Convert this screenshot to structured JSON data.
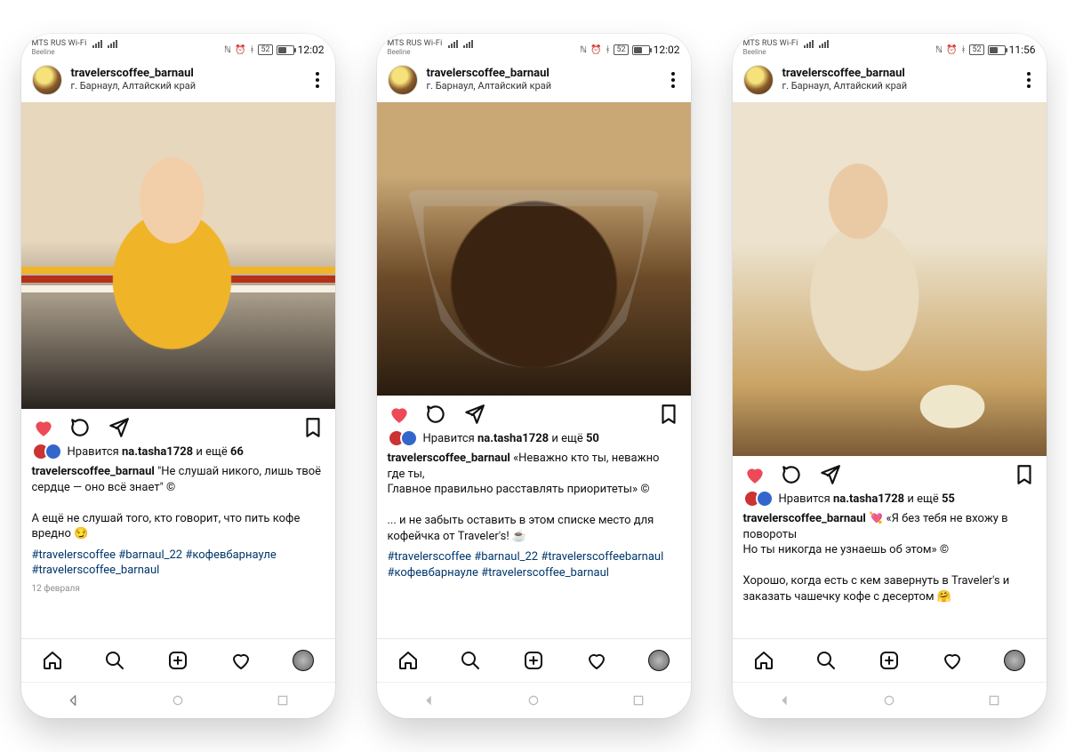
{
  "status": {
    "carrier_line1": "MTS RUS Wi-Fi",
    "carrier_line2": "Beeline",
    "battery_label": "52"
  },
  "account": {
    "username": "travelerscoffee_barnaul",
    "location": "г. Барнаул, Алтайский край"
  },
  "likes": {
    "prefix": "Нравится",
    "user": "na.tasha1728",
    "connector": "и ещё"
  },
  "posts": [
    {
      "time": "12:02",
      "likes_count": "66",
      "caption_lines": [
        "\"Не слушай никого, лишь твоё сердце — оно всё знает\" ©",
        "",
        "А ещё не слушай того, кто говорит, что пить кофе вредно 😏"
      ],
      "tags": "#travelerscoffee #barnaul_22 #кофевбарнауле #travelerscoffee_barnaul",
      "date": "12 февраля"
    },
    {
      "time": "12:02",
      "likes_count": "50",
      "caption_lines": [
        "«Неважно кто ты, неважно где ты,",
        "Главное правильно расставлять приоритеты» ©",
        "",
        "... и не забыть оставить в этом списке место для кофейчка от Traveler's! ☕"
      ],
      "tags": "#travelerscoffee #barnaul_22 #travelerscoffeebarnaul #кофевбарнауле #travelerscoffee_barnaul",
      "date": ""
    },
    {
      "time": "11:56",
      "likes_count": "55",
      "caption_lines": [
        "💘 «Я без тебя не вхожу в повороты",
        "Но ты никогда не узнаешь об этом» ©",
        "",
        "Хорошо, когда есть с кем завернуть в Traveler's и заказать чашечку кофе с десертом 🤗"
      ],
      "tags": "",
      "date": ""
    }
  ]
}
